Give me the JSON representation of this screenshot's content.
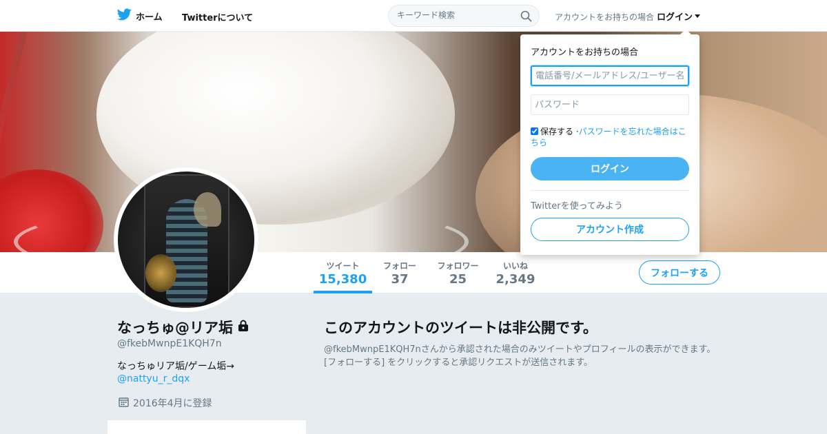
{
  "nav": {
    "home_label": "ホーム",
    "about_label": "Twitterについて",
    "search_placeholder": "キーワード検索",
    "login_prompt": "アカウントをお持ちの場合",
    "login_toggle": "ログイン"
  },
  "profile_nav": {
    "stats": [
      {
        "label": "ツイート",
        "value": "15,380"
      },
      {
        "label": "フォロー",
        "value": "37"
      },
      {
        "label": "フォロワー",
        "value": "25"
      },
      {
        "label": "いいね",
        "value": "2,349"
      }
    ],
    "active_stat": "ツイート",
    "follow_button": "フォローする"
  },
  "profile": {
    "name": "なっちゅ@リア垢",
    "handle": "@fkebMwnpE1KQH7n",
    "bio": "なっちゅリア垢/ゲーム垢→",
    "bio_link": "@nattyu_r_dqx",
    "joined": "2016年4月に登録",
    "protected": true
  },
  "main": {
    "protected_title": "このアカウントのツイートは非公開です。",
    "protected_body": "@fkebMwnpE1KQH7nさんから承認された場合のみツイートやプロフィールの表示ができます。[フォローする] をクリックすると承認リクエストが送信されます。"
  },
  "login_dropdown": {
    "heading": "アカウントをお持ちの場合",
    "username_placeholder": "電話番号/メールアドレス/ユーザー名",
    "password_placeholder": "パスワード",
    "remember_label": "保存する",
    "remember_checked": true,
    "separator": "·",
    "forgot_link": "パスワードを忘れた場合はこちら",
    "login_button": "ログイン",
    "try_twitter": "Twitterを使ってみよう",
    "signup_button": "アカウント作成"
  },
  "colors": {
    "accent": "#1da1f2",
    "login_button_bg": "#4ab3f4",
    "page_bg": "#e6ecf0",
    "secondary_text": "#657786"
  }
}
